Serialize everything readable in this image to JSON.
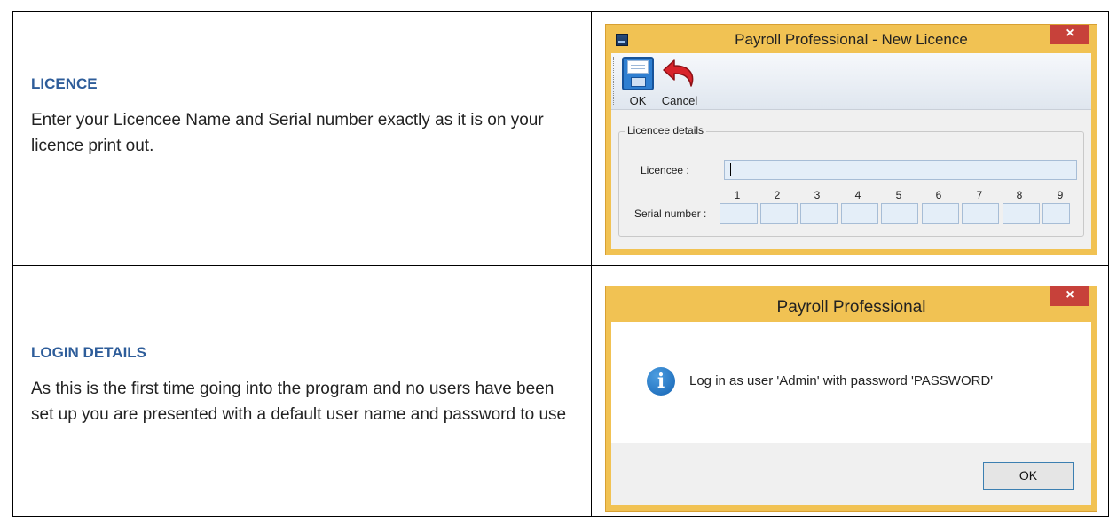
{
  "licence_section": {
    "heading": "LICENCE",
    "body": "Enter your Licencee Name and Serial number exactly as it is on your licence print out."
  },
  "login_section": {
    "heading": "LOGIN DETAILS",
    "body": "As this is the first time going into the program and no users have been set up you are presented with a default user name and password to use"
  },
  "licence_window": {
    "title": "Payroll Professional - New Licence",
    "close_label": "×",
    "toolbar": {
      "ok_label": "OK",
      "cancel_label": "Cancel"
    },
    "group_title": "Licencee details",
    "licencee_label": "Licencee :",
    "licencee_value": "",
    "serial_label": "Serial number :",
    "serial_columns": [
      "1",
      "2",
      "3",
      "4",
      "5",
      "6",
      "7",
      "8",
      "9"
    ],
    "icons": {
      "save": "floppy-disk-icon",
      "cancel": "undo-arrow-icon",
      "app": "app-icon"
    },
    "colors": {
      "frame": "#f1c253",
      "close": "#c7413a",
      "field": "#e4eef8"
    }
  },
  "message_window": {
    "title": "Payroll Professional",
    "close_label": "×",
    "message": "Log in as user 'Admin' with password 'PASSWORD'",
    "ok_label": "OK",
    "icons": {
      "info": "info-icon"
    },
    "info_glyph": "i"
  }
}
